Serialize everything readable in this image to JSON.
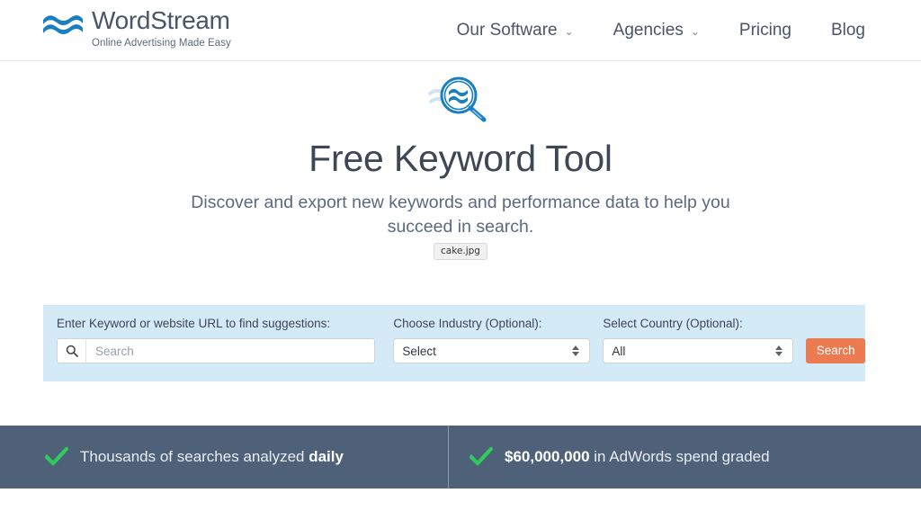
{
  "header": {
    "brand": {
      "name": "WordStream",
      "tagline": "Online Advertising Made Easy",
      "logo_icon": "wave-logo-icon",
      "logo_color": "#1a7fc1"
    },
    "nav": [
      {
        "label": "Our Software",
        "has_dropdown": true,
        "caret": "⌄"
      },
      {
        "label": "Agencies",
        "has_dropdown": true,
        "caret": "⌄"
      },
      {
        "label": "Pricing",
        "has_dropdown": false,
        "caret": ""
      },
      {
        "label": "Blog",
        "has_dropdown": false,
        "caret": ""
      }
    ]
  },
  "hero": {
    "icon": "magnifying-glass-wave-icon",
    "title": "Free Keyword Tool",
    "subtitle": "Discover and export new keywords and performance data to help you succeed in search.",
    "file_chip": "cake.jpg"
  },
  "search_form": {
    "keyword": {
      "label": "Enter Keyword or website URL to find suggestions:",
      "placeholder": "Search",
      "value": "",
      "icon": "search-icon"
    },
    "industry": {
      "label": "Choose Industry (Optional):",
      "selected": "Select"
    },
    "country": {
      "label": "Select Country (Optional):",
      "selected": "All"
    },
    "submit_label": "Search",
    "panel_color": "#d4eaf6",
    "button_color": "#ec7b52"
  },
  "stats": {
    "background_color": "#4f6179",
    "check_color": "#2ecc5a",
    "items": [
      {
        "icon": "check-icon",
        "text_plain": "Thousands of searches analyzed ",
        "text_bold": "daily",
        "bold_first": false
      },
      {
        "icon": "check-icon",
        "text_bold": "$60,000,000",
        "text_plain": " in AdWords spend graded",
        "bold_first": true
      }
    ]
  }
}
